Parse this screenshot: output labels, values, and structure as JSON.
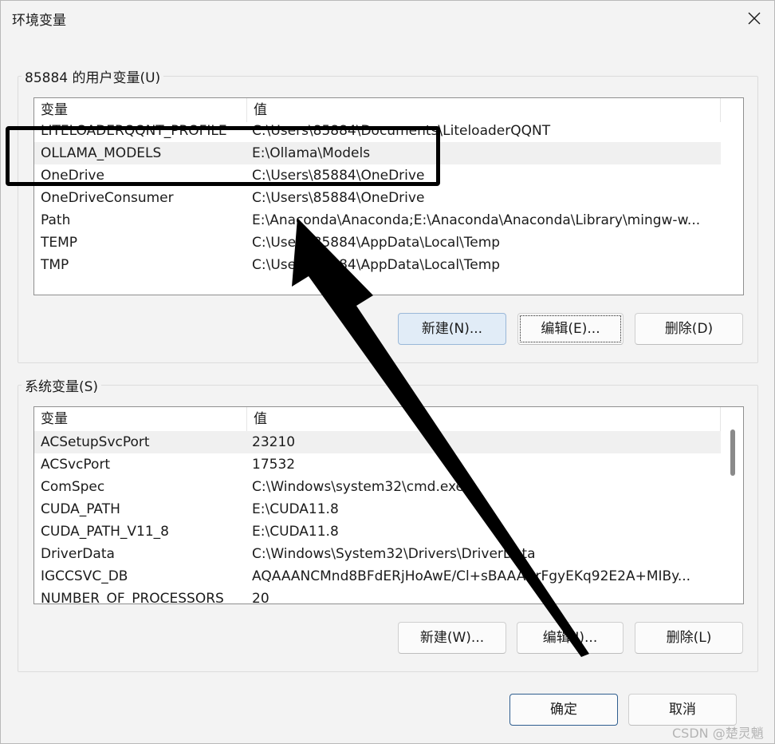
{
  "window": {
    "title": "环境变量",
    "close_icon": "close-icon"
  },
  "user_vars": {
    "group_title": "85884 的用户变量(U)",
    "headers": [
      "变量",
      "值"
    ],
    "rows": [
      {
        "name": "LITELOADERQQNT_PROFILE",
        "value": "C:\\Users\\85884\\Documents\\LiteloaderQQNT"
      },
      {
        "name": "OLLAMA_MODELS",
        "value": "E:\\Ollama\\Models",
        "selected": true
      },
      {
        "name": "OneDrive",
        "value": "C:\\Users\\85884\\OneDrive"
      },
      {
        "name": "OneDriveConsumer",
        "value": "C:\\Users\\85884\\OneDrive"
      },
      {
        "name": "Path",
        "value": "E:\\Anaconda\\Anaconda;E:\\Anaconda\\Anaconda\\Library\\mingw-w..."
      },
      {
        "name": "TEMP",
        "value": "C:\\Users\\85884\\AppData\\Local\\Temp"
      },
      {
        "name": "TMP",
        "value": "C:\\Users\\85884\\AppData\\Local\\Temp"
      }
    ],
    "buttons": {
      "new": "新建(N)...",
      "edit": "编辑(E)...",
      "delete": "删除(D)"
    }
  },
  "system_vars": {
    "group_title": "系统变量(S)",
    "headers": [
      "变量",
      "值"
    ],
    "rows": [
      {
        "name": "ACSetupSvcPort",
        "value": "23210",
        "selected": true
      },
      {
        "name": "ACSvcPort",
        "value": "17532"
      },
      {
        "name": "ComSpec",
        "value": "C:\\Windows\\system32\\cmd.exe"
      },
      {
        "name": "CUDA_PATH",
        "value": "E:\\CUDA11.8"
      },
      {
        "name": "CUDA_PATH_V11_8",
        "value": "E:\\CUDA11.8"
      },
      {
        "name": "DriverData",
        "value": "C:\\Windows\\System32\\Drivers\\DriverData"
      },
      {
        "name": "IGCCSVC_DB",
        "value": "AQAAANCMnd8BFdERjHoAwE/Cl+sBAAAArFgyEKq92E2A+MIBy..."
      },
      {
        "name": "NUMBER_OF_PROCESSORS",
        "value": "20"
      }
    ],
    "buttons": {
      "new": "新建(W)...",
      "edit": "编辑(I)...",
      "delete": "删除(L)"
    }
  },
  "footer": {
    "ok": "确定",
    "cancel": "取消"
  },
  "watermark": "CSDN @楚灵魈",
  "colors": {
    "window_bg": "#f3f3f3",
    "selected_row": "#f0f0f0",
    "button_hover": "#e1ecf7",
    "annotation": "#000000"
  }
}
